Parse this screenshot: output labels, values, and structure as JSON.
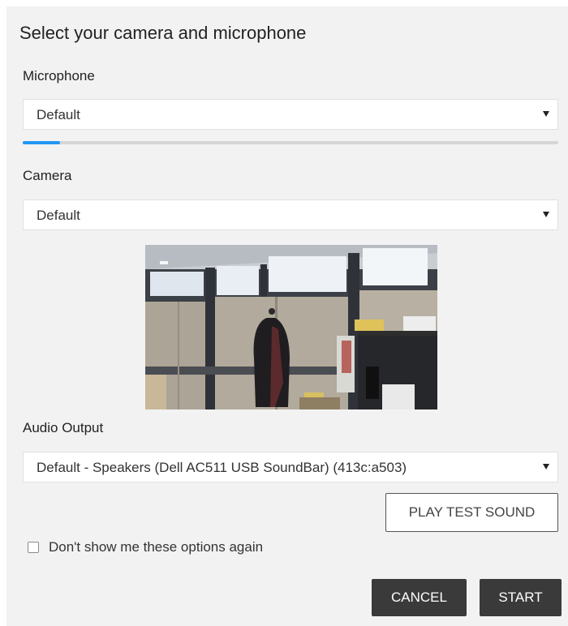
{
  "dialog": {
    "title": "Select your camera and microphone",
    "microphone": {
      "label": "Microphone",
      "selected": "Default",
      "level_percent": 7
    },
    "camera": {
      "label": "Camera",
      "selected": "Default"
    },
    "audio_output": {
      "label": "Audio Output",
      "selected": "Default - Speakers (Dell AC511 USB SoundBar) (413c:a503)"
    },
    "play_test_sound_label": "PLAY TEST SOUND",
    "dont_show_label": "Don't show me these options again",
    "dont_show_checked": false,
    "cancel_label": "CANCEL",
    "start_label": "START"
  },
  "colors": {
    "dialog_bg": "#f2f2f2",
    "accent": "#2196f3",
    "button_dark": "#3a3a3a"
  },
  "icons": {
    "dropdown": "caret-down-icon",
    "checkbox": "checkbox-unchecked"
  }
}
